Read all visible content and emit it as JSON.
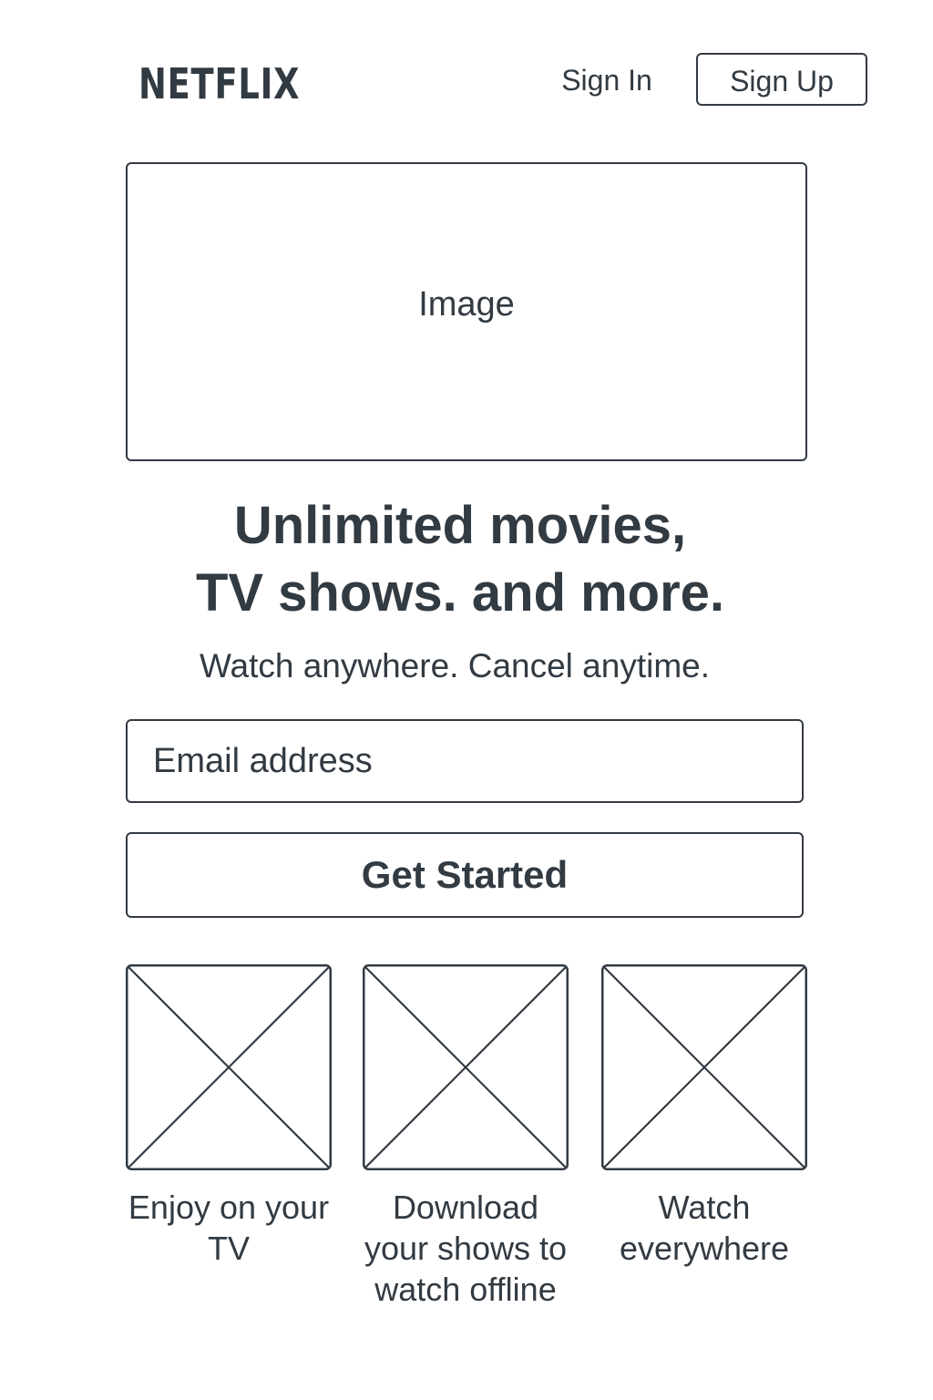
{
  "header": {
    "logo": "NETFLIX",
    "sign_in_label": "Sign In",
    "sign_up_label": "Sign Up"
  },
  "hero": {
    "image_placeholder": "Image",
    "headline_line1": "Unlimited movies,",
    "headline_line2": "TV shows. and more.",
    "subheadline": "Watch anywhere. Cancel anytime."
  },
  "signup_form": {
    "email_placeholder": "Email address",
    "cta_label": "Get Started"
  },
  "features": [
    {
      "caption": "Enjoy on your TV",
      "icon": "image-placeholder-icon"
    },
    {
      "caption": "Download your shows to watch offline",
      "icon": "image-placeholder-icon"
    },
    {
      "caption": "Watch everywhere",
      "icon": "image-placeholder-icon"
    }
  ],
  "colors": {
    "ink": "#323a42",
    "background": "#ffffff"
  }
}
